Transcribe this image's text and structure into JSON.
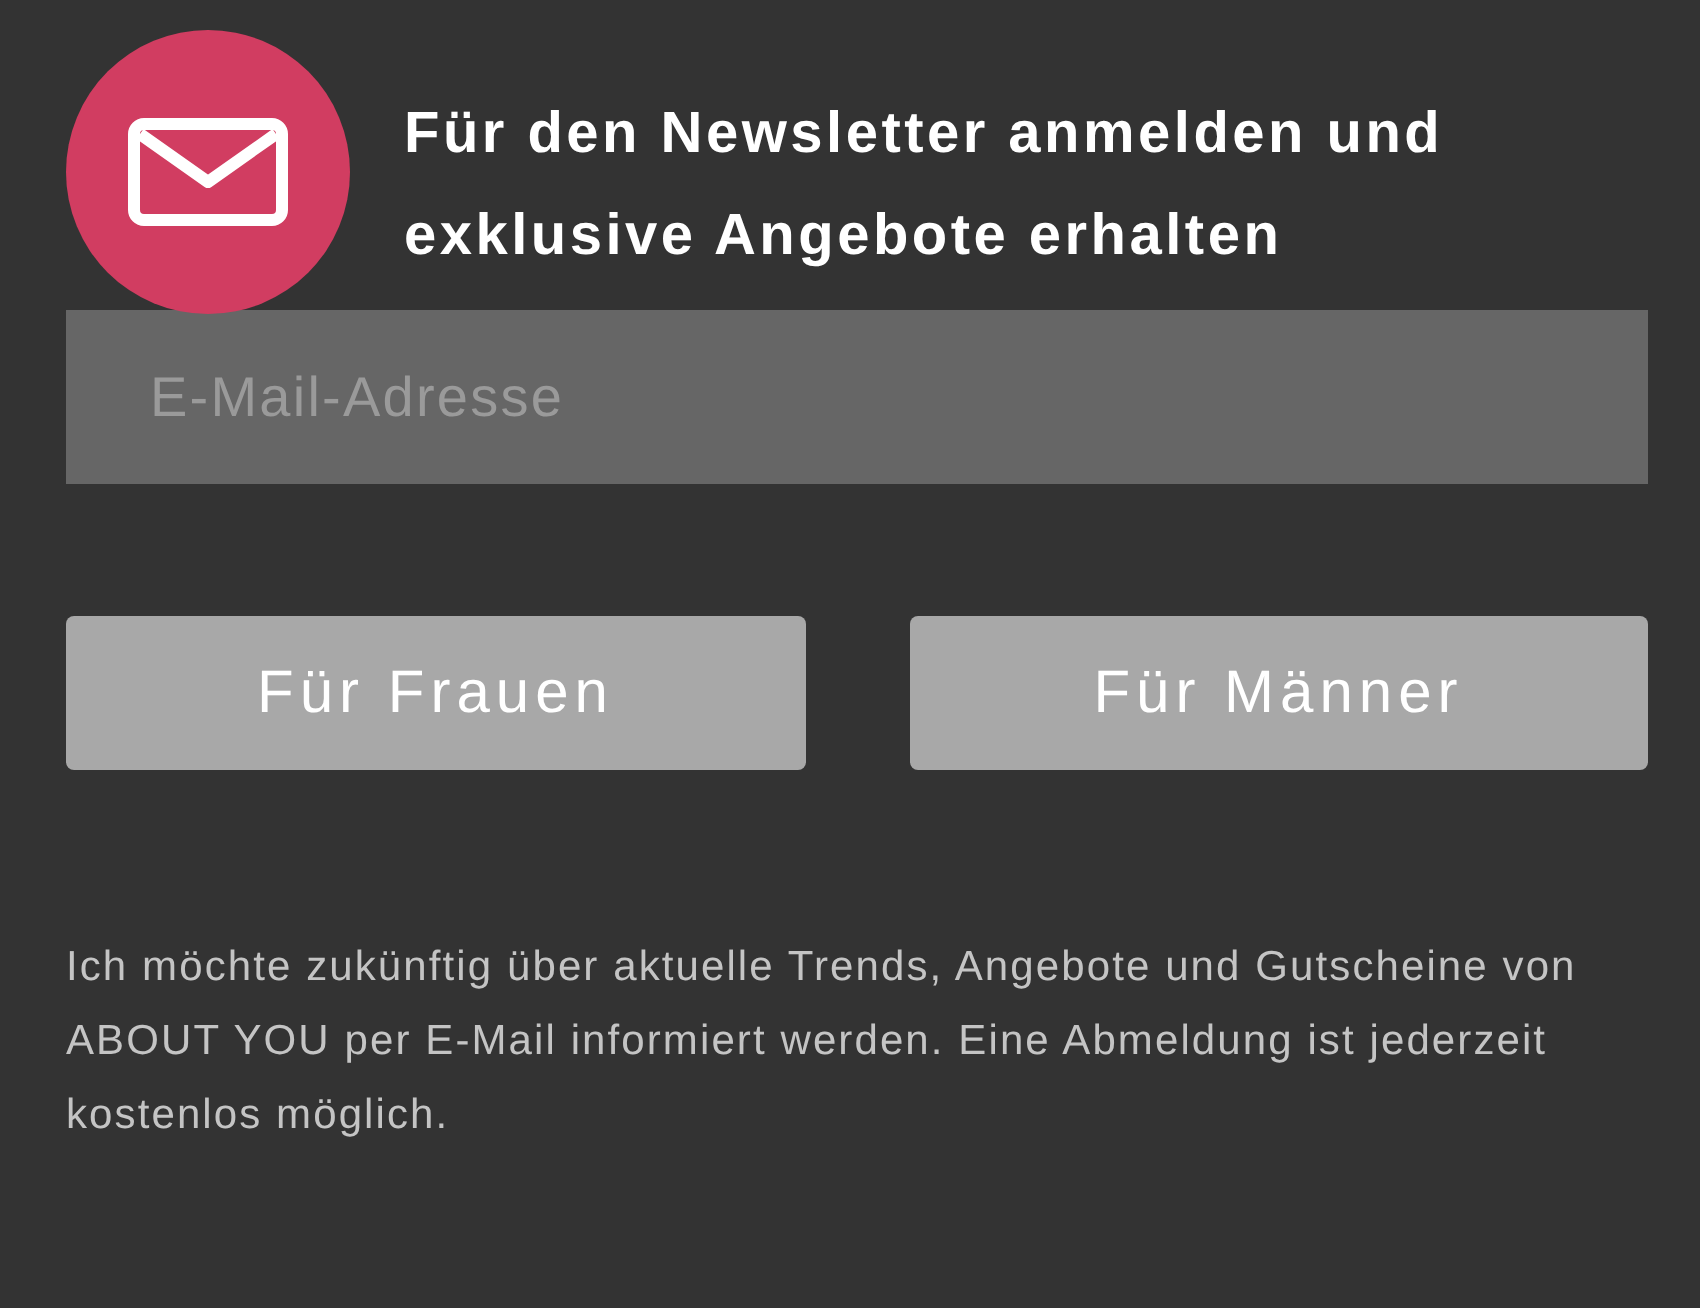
{
  "heading": "Für den Newsletter anmelden und exklusive Angebote erhalten",
  "email_field": {
    "placeholder": "E-Mail-Adresse"
  },
  "buttons": [
    "Für Frauen",
    "Für Männer"
  ],
  "consent_text": "Ich möchte zukünftig über aktuelle Trends, Angebote und Gutscheine von ABOUT YOU per E-Mail informiert werden. Eine Abmeldung ist jederzeit kostenlos möglich."
}
